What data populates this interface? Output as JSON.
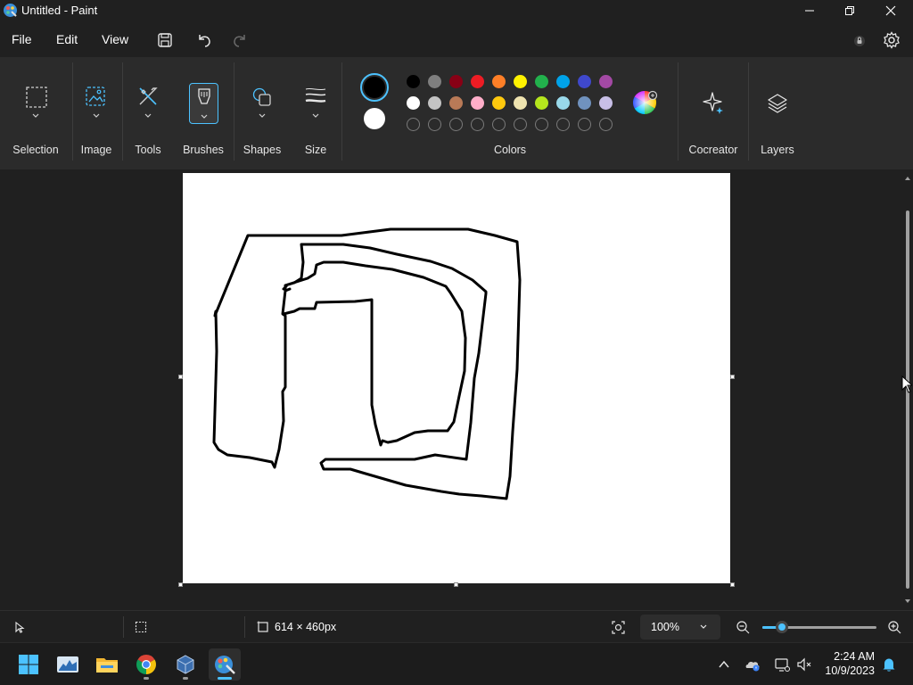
{
  "window": {
    "title": "Untitled - Paint"
  },
  "menu": {
    "file": "File",
    "edit": "Edit",
    "view": "View"
  },
  "ribbon": {
    "groups": {
      "selection": "Selection",
      "image": "Image",
      "tools": "Tools",
      "brushes": "Brushes",
      "shapes": "Shapes",
      "size": "Size",
      "colors": "Colors",
      "cocreator": "Cocreator",
      "layers": "Layers"
    }
  },
  "colors": {
    "accent": "#4cc2ff",
    "primary": "#000000",
    "secondary": "#ffffff",
    "palette_row1": [
      "#000000",
      "#7f7f7f",
      "#880015",
      "#ed1c24",
      "#ff7f27",
      "#fff200",
      "#22b14c",
      "#00a2e8",
      "#3f48cc",
      "#a349a4"
    ],
    "palette_row2": [
      "#ffffff",
      "#c3c3c3",
      "#b97a57",
      "#ffaec9",
      "#ffc90e",
      "#efe4b0",
      "#b5e61d",
      "#99d9ea",
      "#7092be",
      "#c8bfe7"
    ],
    "custom_slots": 10
  },
  "canvas": {
    "dimensions": "614 × 460px"
  },
  "status": {
    "zoom": "100%",
    "zoom_fraction": 0.17
  },
  "taskbar": {
    "apps": [
      "start-icon",
      "task-manager-icon",
      "file-explorer-icon",
      "chrome-icon",
      "virtualbox-icon",
      "paint-icon"
    ],
    "time": "2:24 AM",
    "date": "10/9/2023"
  }
}
